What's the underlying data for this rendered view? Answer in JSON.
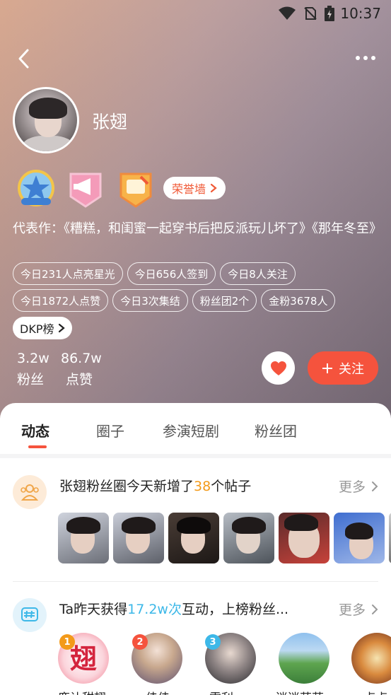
{
  "status": {
    "time": "10:37"
  },
  "profile": {
    "name": "张翅",
    "honor_label": "荣誉墙",
    "works": "代表作：《糟糕，和闺蜜一起穿书后把反派玩儿坏了》《那年冬至》",
    "tags_row1": [
      "今日231人点亮星光",
      "今日656人签到",
      "今日8人关注"
    ],
    "tags_row2": [
      "今日1872人点赞",
      "今日3次集结",
      "粉丝团2个",
      "金粉3678人"
    ],
    "dkp_label": "DKP榜",
    "fans_count": "3.2w",
    "fans_label": "粉丝",
    "likes_count": "86.7w",
    "likes_label": "点赞",
    "follow_label": "关注",
    "badges": [
      "badge-1",
      "badge-2",
      "badge-3"
    ]
  },
  "tabs": [
    "动态",
    "圈子",
    "参演短剧",
    "粉丝团"
  ],
  "card_circle": {
    "title_prefix": "张翅粉丝圈今天新增了",
    "highlight": "38",
    "title_suffix": "个帖子",
    "more": "更多"
  },
  "card_rank": {
    "title_prefix": "Ta昨天获得",
    "highlight": "17.2w次",
    "title_suffix": "互动，上榜粉丝...",
    "more": "更多"
  },
  "fans": [
    {
      "rank": "1",
      "name": "鹿让甜翅"
    },
    {
      "rank": "2",
      "name": "佳佳"
    },
    {
      "rank": "3",
      "name": "雷利"
    },
    {
      "rank": "",
      "name": "迷迷茫茫"
    },
    {
      "rank": "",
      "name": "卢卢"
    }
  ],
  "colors": {
    "accent": "#f5533d",
    "highlight_orange": "#f39a1a",
    "highlight_blue": "#3db8e8"
  }
}
